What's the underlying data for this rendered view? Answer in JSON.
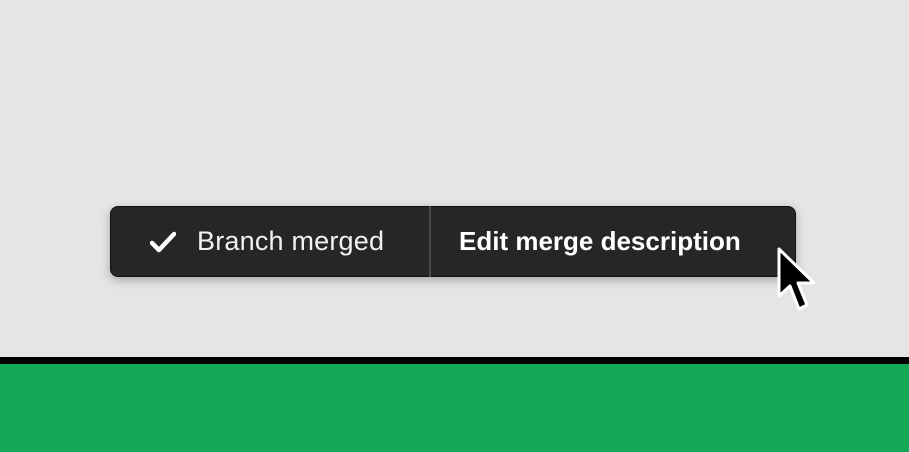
{
  "toast": {
    "status_icon": "checkmark-icon",
    "message": "Branch merged",
    "action_label": "Edit merge description"
  },
  "cursor": {
    "icon": "arrow-pointer-icon"
  },
  "colors": {
    "canvas_bg": "#e5e5e5",
    "toast_bg": "#262626",
    "toast_text": "#ffffff",
    "divider": "#000000",
    "footer": "#12a856"
  }
}
